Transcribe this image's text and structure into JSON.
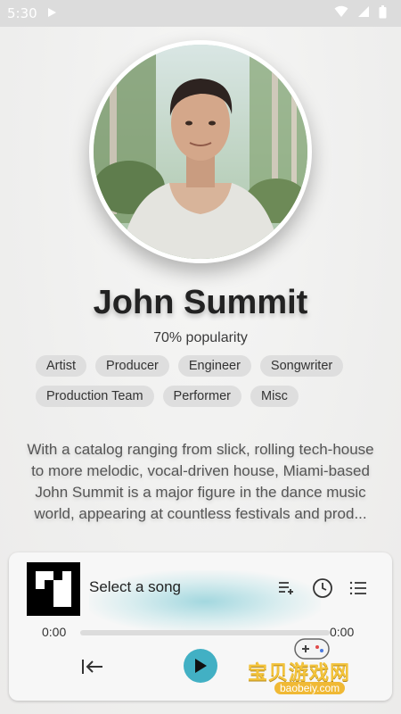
{
  "status_bar": {
    "time": "5:30"
  },
  "artist": {
    "name": "John Summit",
    "popularity": "70% popularity",
    "tags": [
      "Artist",
      "Producer",
      "Engineer",
      "Songwriter",
      "Production Team",
      "Performer",
      "Misc"
    ],
    "bio": "With a catalog ranging from slick, rolling tech-house to more melodic, vocal-driven house, Miami-based John Summit is a major figure in the dance music world, appearing at countless festivals and prod..."
  },
  "player": {
    "song_title": "Select a song",
    "elapsed": "0:00",
    "duration": "0:00",
    "progress": 0,
    "accent_color": "#42b0c4",
    "icons": {
      "queue_add": "queue-add-icon",
      "history": "history-icon",
      "queue_list": "queue-list-icon",
      "previous": "skip-previous-icon",
      "play": "play-icon"
    }
  },
  "watermark": {
    "text": "宝贝游戏网",
    "url": "baobeiy.com"
  }
}
